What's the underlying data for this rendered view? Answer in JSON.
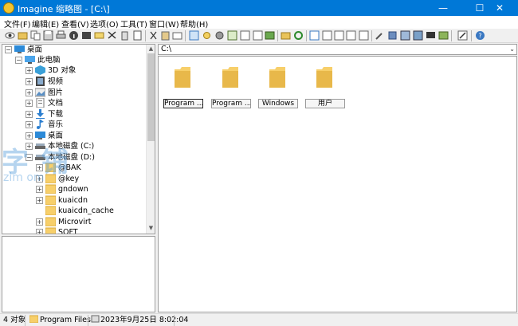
{
  "window": {
    "title": "Imagine 缩略图 - [C:\\]",
    "min": "—",
    "max": "☐",
    "close": "✕"
  },
  "menu": [
    "文件(F)",
    "编辑(E)",
    "查看(V)",
    "选项(O)",
    "工具(T)",
    "窗口(W)",
    "帮助(H)"
  ],
  "tree": {
    "items": [
      {
        "label": "桌面",
        "icon": "desktop-icon"
      },
      {
        "label": "此电脑",
        "icon": "computer-icon"
      },
      {
        "label": "3D 对象",
        "icon": "3d-objects-icon"
      },
      {
        "label": "视频",
        "icon": "video-icon"
      },
      {
        "label": "图片",
        "icon": "pictures-icon"
      },
      {
        "label": "文档",
        "icon": "documents-icon"
      },
      {
        "label": "下载",
        "icon": "download-icon"
      },
      {
        "label": "音乐",
        "icon": "music-icon"
      },
      {
        "label": "桌面",
        "icon": "desktop-icon"
      },
      {
        "label": "本地磁盘 (C:)",
        "icon": "drive-icon"
      },
      {
        "label": "本地磁盘 (D:)",
        "icon": "drive-icon"
      },
      {
        "label": "@BAK",
        "icon": "folder-icon"
      },
      {
        "label": "@key",
        "icon": "folder-icon"
      },
      {
        "label": "gndown",
        "icon": "folder-icon"
      },
      {
        "label": "kuaicdn",
        "icon": "folder-icon"
      },
      {
        "label": "kuaicdn_cache",
        "icon": "folder-icon"
      },
      {
        "label": "Microvirt",
        "icon": "folder-icon"
      },
      {
        "label": "SOFT",
        "icon": "folder-icon"
      }
    ]
  },
  "address": {
    "value": "C:\\"
  },
  "thumbnails": [
    {
      "label": "Program ..."
    },
    {
      "label": "Program ..."
    },
    {
      "label": "Windows"
    },
    {
      "label": "用户"
    }
  ],
  "status": {
    "count": "4 对象",
    "selected": "Program Files",
    "datetime": "2023年9月25日 8:02:04"
  },
  "watermark": {
    "big": "字 铺",
    "small": "zim  om"
  },
  "colors": {
    "titlebar": "#0078d7",
    "folder": "#f7cf6a",
    "folder_dark": "#e8b84a"
  }
}
